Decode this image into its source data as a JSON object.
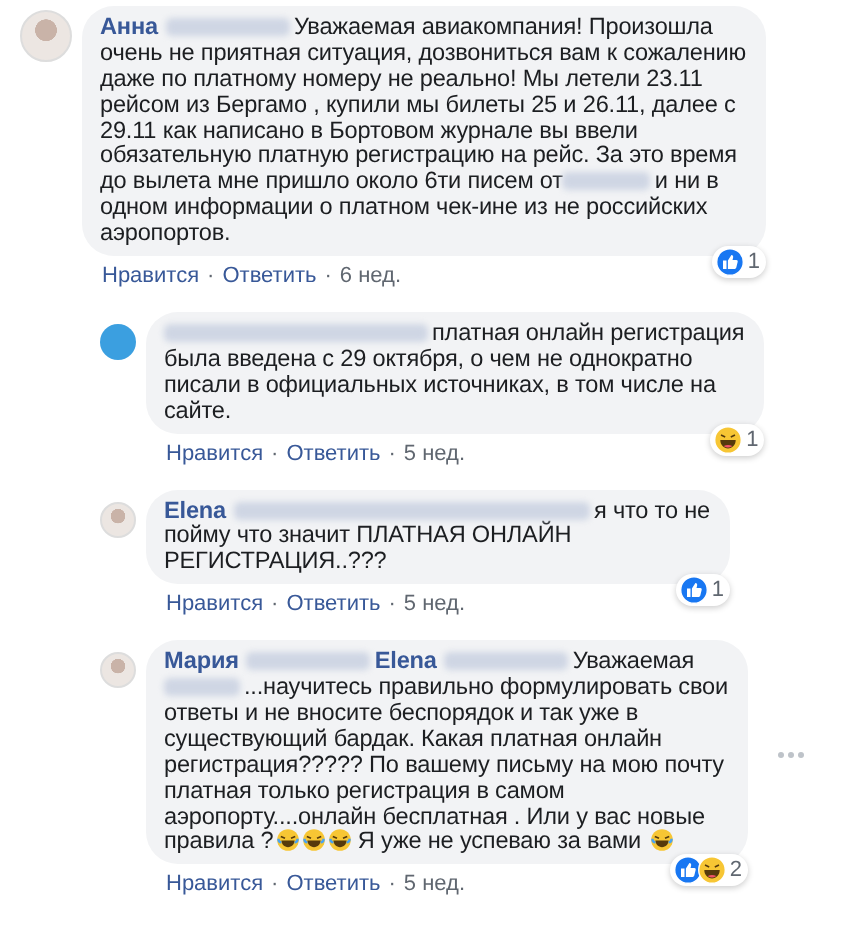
{
  "comments": [
    {
      "reply": false,
      "avatar": {
        "kind": "photo"
      },
      "more_menu": false,
      "lines": [
        [
          {
            "kind": "name",
            "text": "Анна"
          },
          {
            "kind": "redacted_long"
          },
          {
            "kind": "text",
            "text": "Уважаемая авиакомпания! Произошла"
          }
        ],
        [
          {
            "kind": "text",
            "text": "очень не приятная ситуация, дозвониться вам к сожалению"
          }
        ],
        [
          {
            "kind": "text",
            "text": "даже по платному номеру не реально! Мы летели 23.11"
          }
        ],
        [
          {
            "kind": "text",
            "text": "рейсом из Бергамо , купили мы билеты 25 и 26.11, далее с"
          }
        ],
        [
          {
            "kind": "text",
            "text": "29.11 как написано в Бортовом журнале вы ввели"
          }
        ],
        [
          {
            "kind": "text",
            "text": "обязательную платную регистрацию на рейс. За это время"
          }
        ],
        [
          {
            "kind": "text",
            "text": "до вылета мне пришло около 6ти писем от"
          },
          {
            "kind": "redacted_medium"
          },
          {
            "kind": "text",
            "text": "и ни в"
          }
        ],
        [
          {
            "kind": "text",
            "text": "одном информации о платном чек-ине из не российских"
          }
        ],
        [
          {
            "kind": "text",
            "text": "аэропортов."
          }
        ]
      ],
      "actions": [
        "Нравится",
        "Ответить"
      ],
      "separator": "·",
      "time": "6 нед.",
      "reactions": {
        "types": [
          {
            "kind": "like"
          }
        ],
        "count": "1"
      }
    },
    {
      "reply": true,
      "avatar": {
        "kind": "page"
      },
      "more_menu": false,
      "lines": [
        [
          {
            "kind": "redacted_xlong"
          },
          {
            "kind": "text",
            "text": "платная онлайн регистрация"
          }
        ],
        [
          {
            "kind": "text",
            "text": "была введена с 29 октября, о чем не однократно"
          }
        ],
        [
          {
            "kind": "text",
            "text": "писали в официальных источниках, в том числе на"
          }
        ],
        [
          {
            "kind": "text",
            "text": "сайте."
          }
        ]
      ],
      "actions": [
        "Нравится",
        "Ответить"
      ],
      "separator": "·",
      "time": "5 нед.",
      "reactions": {
        "types": [
          {
            "kind": "haha"
          }
        ],
        "count": "1"
      }
    },
    {
      "reply": true,
      "avatar": {
        "kind": "photo"
      },
      "more_menu": false,
      "lines": [
        [
          {
            "kind": "name",
            "text": "Elena"
          },
          {
            "kind": "redacted_xxlong"
          },
          {
            "kind": "text",
            "text": "я что то не"
          }
        ],
        [
          {
            "kind": "text",
            "text": "пойму что значит ПЛАТНАЯ ОНЛАЙН"
          }
        ],
        [
          {
            "kind": "text",
            "text": "РЕГИСТРАЦИЯ..???"
          }
        ]
      ],
      "actions": [
        "Нравится",
        "Ответить"
      ],
      "separator": "·",
      "time": "5 нед.",
      "reactions": {
        "types": [
          {
            "kind": "like"
          }
        ],
        "count": "1"
      }
    },
    {
      "reply": true,
      "avatar": {
        "kind": "photo"
      },
      "more_menu": true,
      "lines": [
        [
          {
            "kind": "name",
            "text": "Мария"
          },
          {
            "kind": "redacted_long"
          },
          {
            "kind": "name",
            "text": "Elena"
          },
          {
            "kind": "redacted_long"
          },
          {
            "kind": "text",
            "text": "Уважаемая"
          }
        ],
        [
          {
            "kind": "redacted_short"
          },
          {
            "kind": "text",
            "text": "...научитесь правильно формулировать свои"
          }
        ],
        [
          {
            "kind": "text",
            "text": "ответы и не вносите беспорядок и так уже в"
          }
        ],
        [
          {
            "kind": "text",
            "text": "существующий бардак. Какая платная онлайн"
          }
        ],
        [
          {
            "kind": "text",
            "text": "регистрация????? По вашему письму на мою почту"
          }
        ],
        [
          {
            "kind": "text",
            "text": "платная только регистрация в самом"
          }
        ],
        [
          {
            "kind": "text",
            "text": "аэропорту....онлайн бесплатная . Или у вас новые"
          }
        ],
        [
          {
            "kind": "text",
            "text": "правила ?"
          },
          {
            "kind": "laugh"
          },
          {
            "kind": "laugh"
          },
          {
            "kind": "laugh"
          },
          {
            "kind": "text",
            "text": " Я уже не успеваю за вами "
          },
          {
            "kind": "laugh"
          }
        ]
      ],
      "actions": [
        "Нравится",
        "Ответить"
      ],
      "separator": "·",
      "time": "5 нед.",
      "reactions": {
        "types": [
          {
            "kind": "like"
          },
          {
            "kind": "haha"
          }
        ],
        "count": "2"
      }
    }
  ]
}
